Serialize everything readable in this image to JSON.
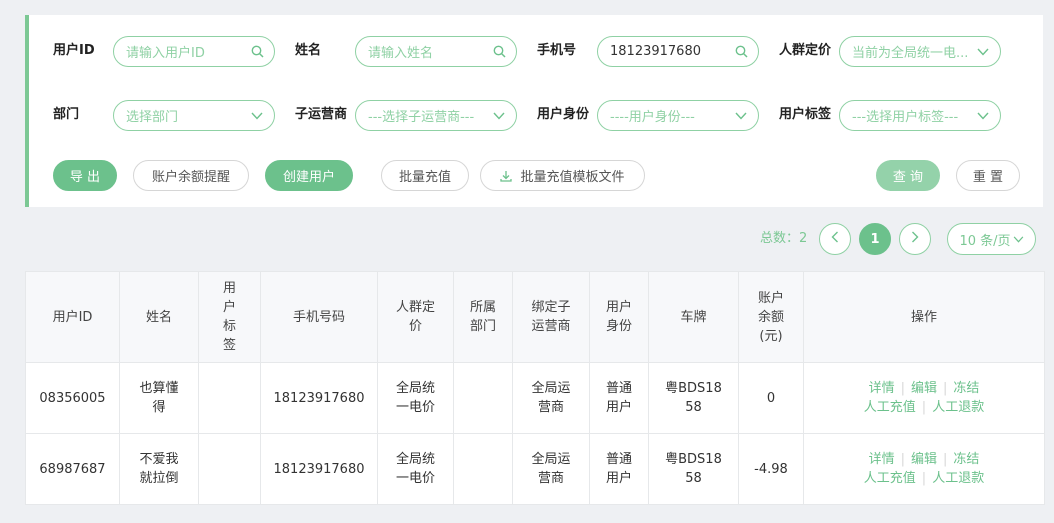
{
  "filters": {
    "row1": [
      {
        "label": "用户ID",
        "value": "",
        "placeholder": "请输入用户ID",
        "icon": "search-icon"
      },
      {
        "label": "姓名",
        "value": "",
        "placeholder": "请输入姓名",
        "icon": "search-icon"
      },
      {
        "label": "手机号",
        "value": "18123917680",
        "placeholder": "",
        "icon": "search-icon"
      },
      {
        "label": "人群定价",
        "value": "",
        "placeholder": "当前为全局统一电...",
        "icon": "chevron-down-icon"
      }
    ],
    "row2": [
      {
        "label": "部门",
        "value": "",
        "placeholder": "选择部门",
        "icon": "chevron-down-icon"
      },
      {
        "label": "子运营商",
        "value": "",
        "placeholder": "---选择子运营商---",
        "icon": "chevron-down-icon"
      },
      {
        "label": "用户身份",
        "value": "",
        "placeholder": "----用户身份---",
        "icon": "chevron-down-icon"
      },
      {
        "label": "用户标签",
        "value": "",
        "placeholder": "---选择用户标签---",
        "icon": "chevron-down-icon"
      }
    ]
  },
  "actions": {
    "export": "导 出",
    "balance_alert": "账户余额提醒",
    "create_user": "创建用户",
    "batch_recharge": "批量充值",
    "batch_template": "批量充值模板文件",
    "query": "查 询",
    "reset": "重 置"
  },
  "pagination": {
    "total_label": "总数：2",
    "current_page": "1",
    "page_size": "10 条/页"
  },
  "table": {
    "headers": [
      "用户ID",
      "姓名",
      "用户标签",
      "手机号码",
      "人群定价",
      "所属部门",
      "绑定子运营商",
      "用户身份",
      "车牌",
      "账户余额(元)",
      "操作"
    ],
    "rows": [
      {
        "user_id": "08356005",
        "name": "也算懂得",
        "tag": "",
        "phone": "18123917680",
        "pricing": "全局统一电价",
        "dept": "",
        "operator": "全局运营商",
        "identity": "普通用户",
        "plate": "粤BDS1858",
        "balance": "0"
      },
      {
        "user_id": "68987687",
        "name": "不爱我就拉倒",
        "tag": "",
        "phone": "18123917680",
        "pricing": "全局统一电价",
        "dept": "",
        "operator": "全局运营商",
        "identity": "普通用户",
        "plate": "粤BDS1858",
        "balance": "-4.98"
      }
    ],
    "ops": {
      "detail": "详情",
      "edit": "编辑",
      "freeze": "冻结",
      "manual_recharge": "人工充值",
      "manual_refund": "人工退款"
    }
  },
  "colors": {
    "accent": "#6cc18c",
    "accent_light": "#8fd1a4",
    "page_bg": "#eef0f3"
  }
}
